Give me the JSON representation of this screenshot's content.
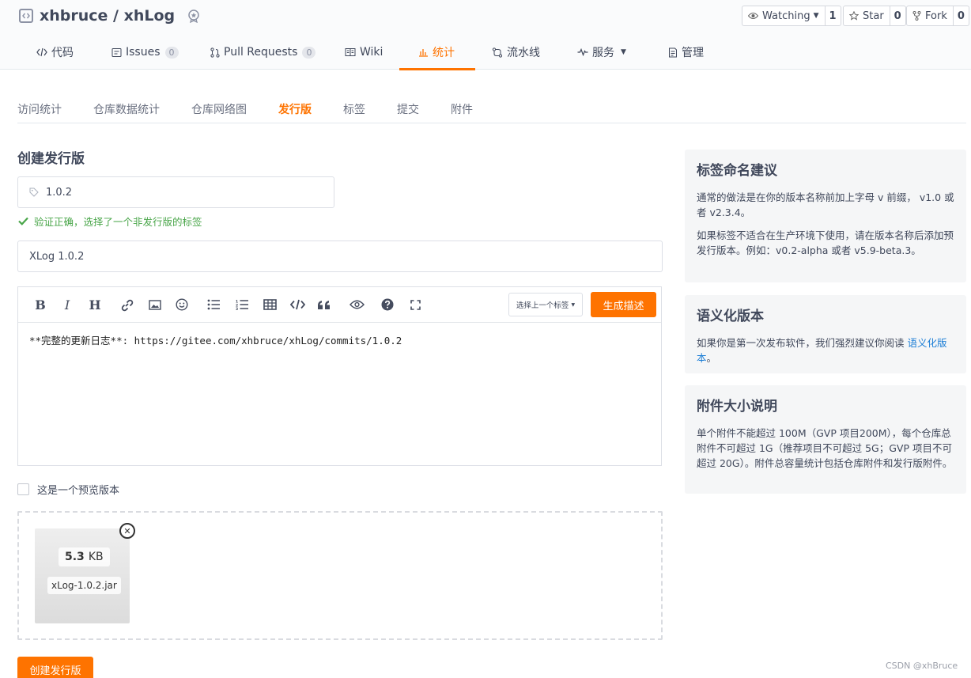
{
  "repo": {
    "owner": "xhbruce",
    "separator": " / ",
    "name": "xhLog"
  },
  "social": {
    "watch": {
      "label": "Watching",
      "count": "1"
    },
    "star": {
      "label": "Star",
      "count": "0"
    },
    "fork": {
      "label": "Fork",
      "count": "0"
    }
  },
  "nav": {
    "code": "代码",
    "issues": "Issues",
    "issues_count": "0",
    "pulls": "Pull Requests",
    "pulls_count": "0",
    "wiki": "Wiki",
    "stats": "统计",
    "pipeline": "流水线",
    "services": "服务",
    "manage": "管理"
  },
  "subtabs": [
    "访问统计",
    "仓库数据统计",
    "仓库网络图",
    "发行版",
    "标签",
    "提交",
    "附件"
  ],
  "form": {
    "heading": "创建发行版",
    "tag_value": "1.0.2",
    "validation": "验证正确，选择了一个非发行版的标签",
    "title_value": "XLog 1.0.2",
    "select_prev_tag": "选择上一个标签",
    "generate_label": "生成描述",
    "body_text": "**完整的更新日志**: https://gitee.com/xhbruce/xhLog/commits/1.0.2",
    "prerelease_label": "这是一个预览版本",
    "submit_label": "创建发行版"
  },
  "attachment": {
    "size_value": "5.3",
    "size_unit": "KB",
    "filename": "xLog-1.0.2.jar"
  },
  "sidebar": {
    "tag_naming": {
      "title": "标签命名建议",
      "p1": "通常的做法是在你的版本名称前加上字母 v 前缀， v1.0 或者 v2.3.4。",
      "p2": "如果标签不适合在生产环境下使用，请在版本名称后添加预发行版本。例如：v0.2-alpha 或者 v5.9-beta.3。"
    },
    "semver": {
      "title": "语义化版本",
      "text": "如果你是第一次发布软件，我们强烈建议你阅读 ",
      "link": "语义化版本",
      "suffix": "。"
    },
    "attach_size": {
      "title": "附件大小说明",
      "text": "单个附件不能超过 100M（GVP 项目200M），每个仓库总附件不可超过 1G（推荐项目不可超过 5G；GVP 项目不可超过 20G）。附件总容量统计包括仓库附件和发行版附件。"
    }
  },
  "watermark": "CSDN @xhBruce",
  "colors": {
    "accent": "#fe7300",
    "success": "#4aa64a",
    "link": "#1e7fd6"
  }
}
